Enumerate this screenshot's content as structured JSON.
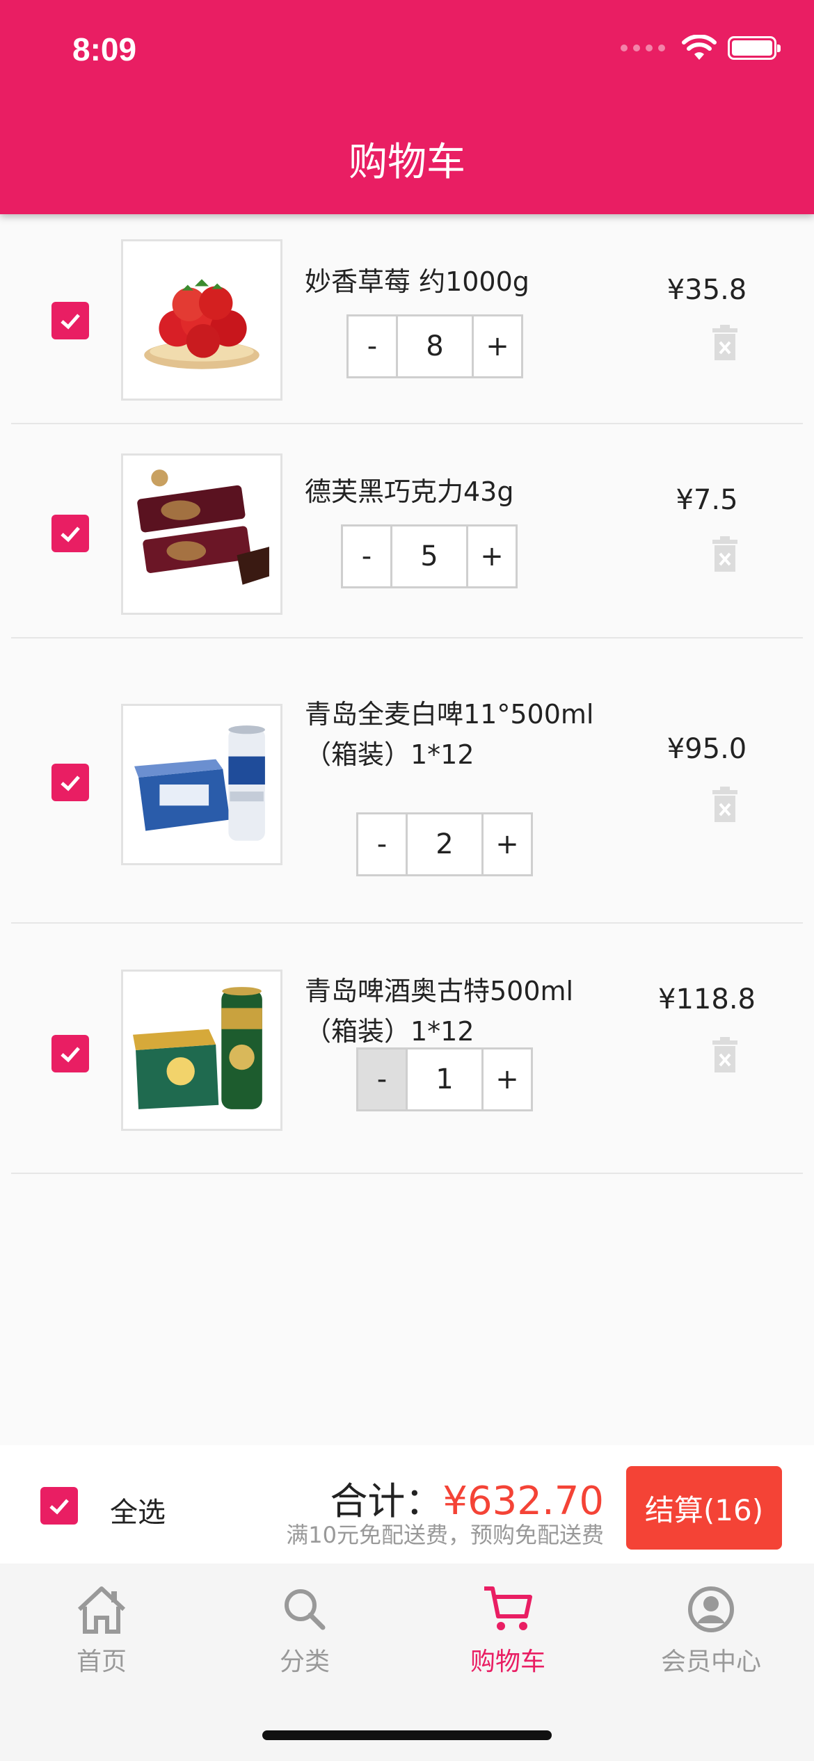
{
  "status_bar": {
    "time": "8:09"
  },
  "header": {
    "title": "购物车"
  },
  "items": [
    {
      "name": "妙香草莓 约1000g",
      "quantity": "8",
      "price": "¥35.8",
      "checked": true,
      "image": "strawberry-image"
    },
    {
      "name": "德芙黑巧克力43g",
      "quantity": "5",
      "price": "¥7.5",
      "checked": true,
      "image": "dove-chocolate-image"
    },
    {
      "name": "青岛全麦白啤11°500ml（箱装）1*12",
      "quantity": "2",
      "price": "¥95.0",
      "checked": true,
      "image": "tsingtao-wheat-beer-image"
    },
    {
      "name": "青岛啤酒奥古特500ml（箱装）1*12",
      "quantity": "1",
      "price": "¥118.8",
      "checked": true,
      "image": "tsingtao-augerta-beer-image"
    }
  ],
  "stepper": {
    "minus": "-",
    "plus": "+"
  },
  "summary": {
    "select_all_label": "全选",
    "total_label": "合计：",
    "total_value": "¥632.70",
    "free_shipping_note": "满10元免配送费，预购免配送费",
    "checkout_label": "结算(16)"
  },
  "tabs": [
    {
      "label": "首页",
      "icon": "home-icon",
      "active": false
    },
    {
      "label": "分类",
      "icon": "search-icon",
      "active": false
    },
    {
      "label": "购物车",
      "icon": "cart-icon",
      "active": true
    },
    {
      "label": "会员中心",
      "icon": "user-icon",
      "active": false
    }
  ],
  "colors": {
    "primary": "#e91e63",
    "accent": "#f44336",
    "muted": "#999999"
  }
}
